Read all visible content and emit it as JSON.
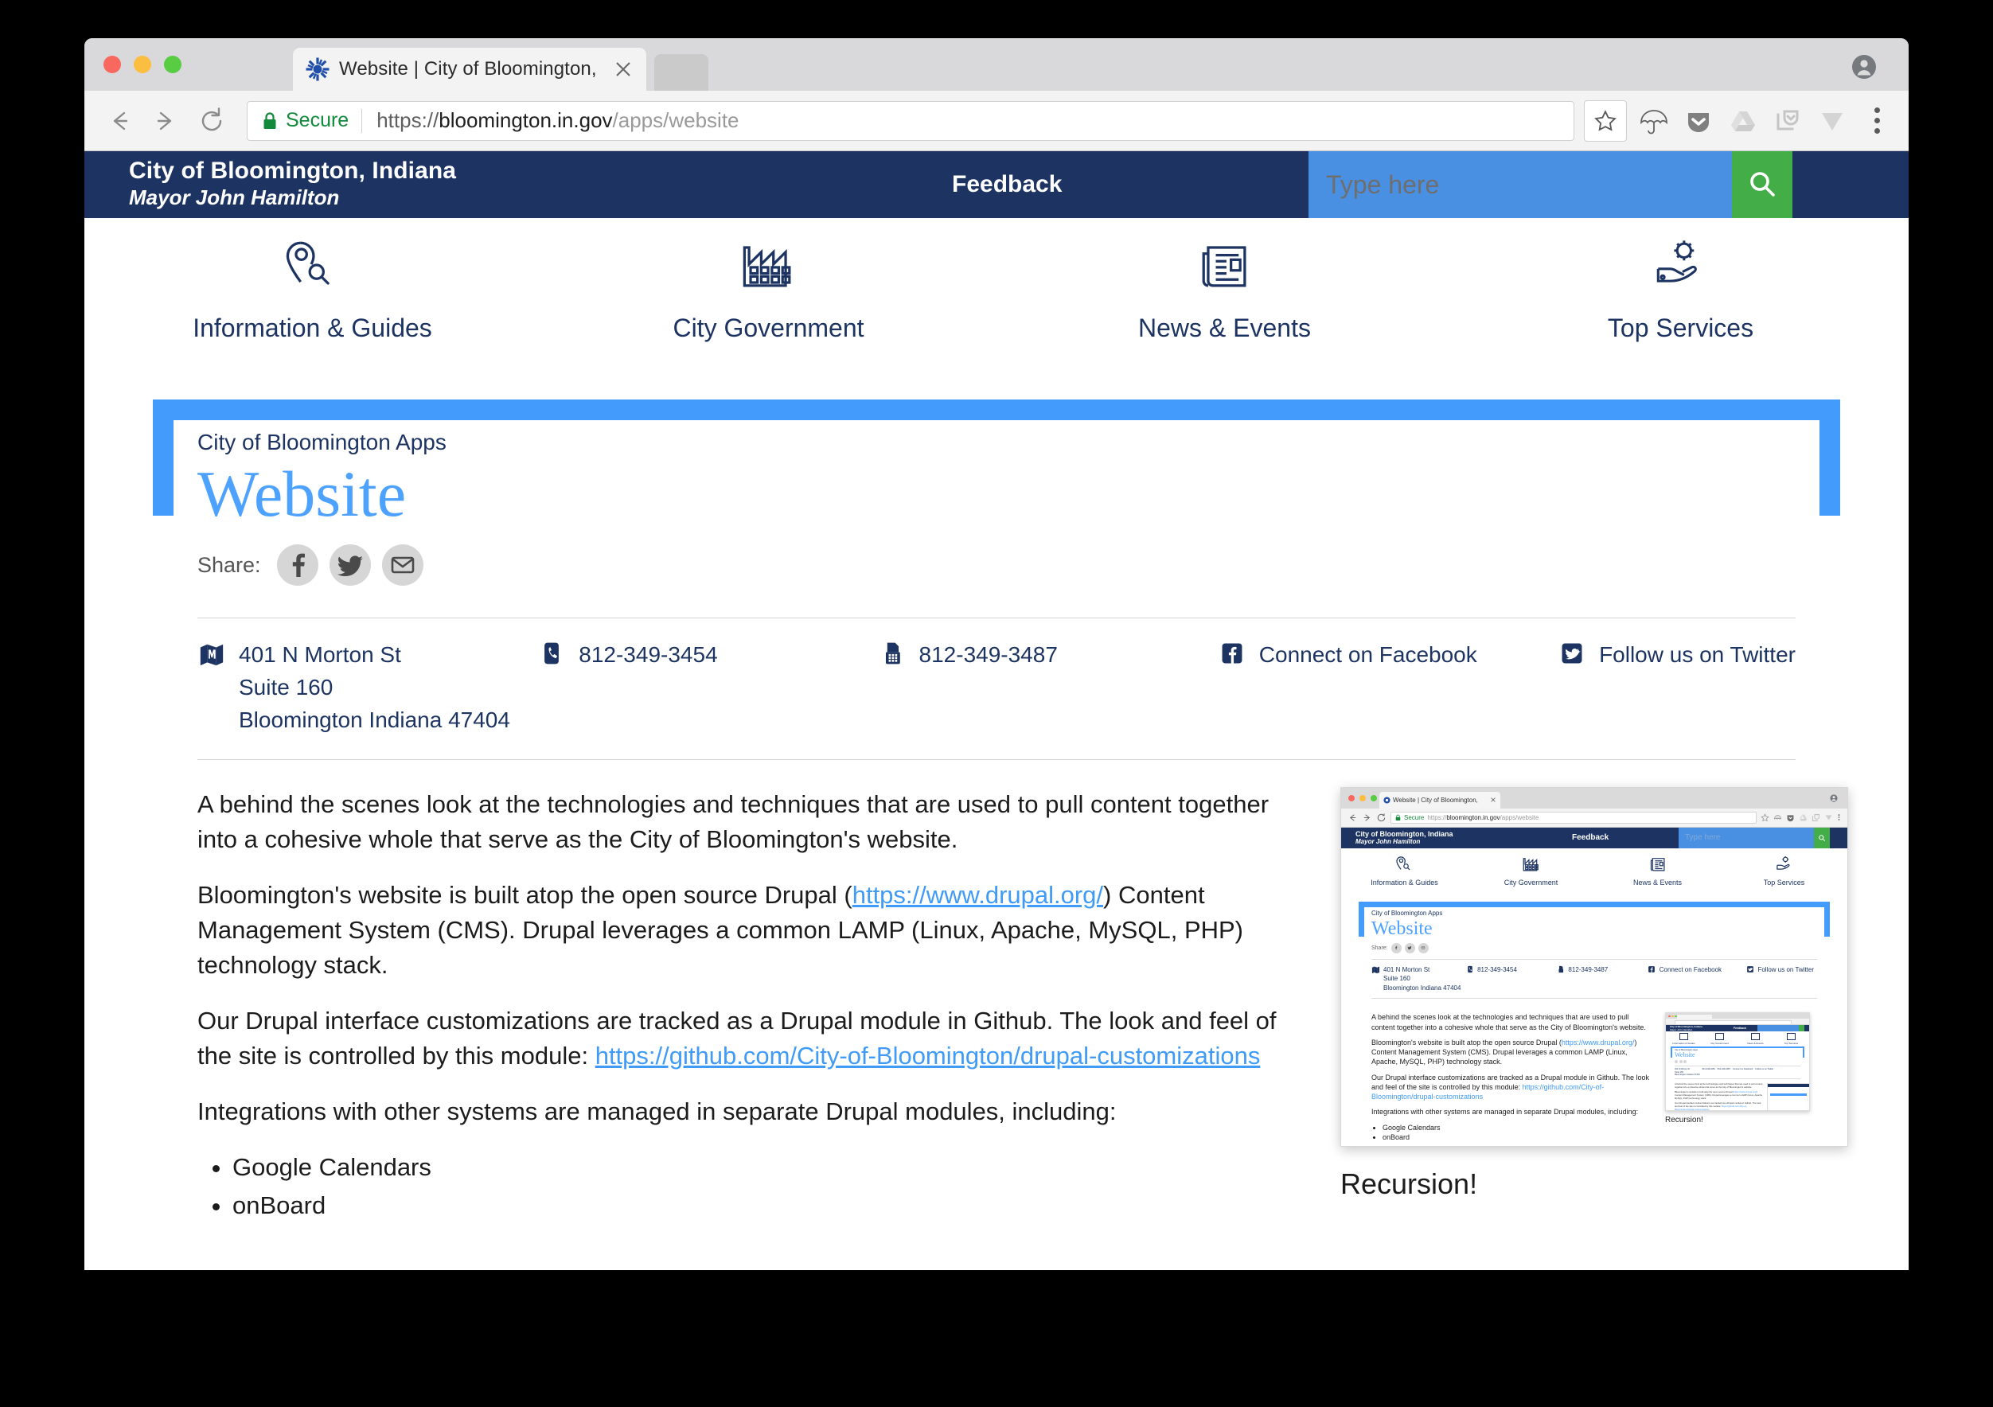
{
  "browser": {
    "tab_title": "Website | City of Bloomington,",
    "secure_label": "Secure",
    "url_scheme": "https://",
    "url_domain": "bloomington.in.gov",
    "url_path": "/apps/website",
    "icons": {
      "back": "back-arrow-icon",
      "forward": "forward-arrow-icon",
      "reload": "reload-icon",
      "lock": "lock-icon",
      "bookmark": "star-icon",
      "ext_umbrella": "umbrella-icon",
      "ext_pocket": "pocket-icon",
      "ext_drive": "google-drive-icon",
      "ext_save": "save-to-pocket-icon",
      "ext_v": "v-logo-icon",
      "menu": "three-dot-menu-icon",
      "profile": "user-avatar-icon",
      "close_tab": "close-icon",
      "favicon": "bloomington-favicon"
    }
  },
  "site_header": {
    "org_name": "City of Bloomington, Indiana",
    "mayor": "Mayor John Hamilton",
    "feedback": "Feedback",
    "search_placeholder": "Type here",
    "search_value": "",
    "search_icon": "search-icon",
    "colors": {
      "navy": "#1d3462",
      "search_blue": "#4a90e2",
      "green": "#43ad47",
      "accent_blue": "#439cfb"
    }
  },
  "nav": {
    "items": [
      {
        "label": "Information & Guides",
        "icon": "map-pin-search-icon"
      },
      {
        "label": "City Government",
        "icon": "factory-icon"
      },
      {
        "label": "News & Events",
        "icon": "newspaper-icon"
      },
      {
        "label": "Top Services",
        "icon": "hand-gear-icon"
      }
    ]
  },
  "page": {
    "eyebrow": "City of Bloomington Apps",
    "title": "Website",
    "share_label": "Share:",
    "share_buttons": [
      {
        "icon": "facebook-icon",
        "name": "share-facebook"
      },
      {
        "icon": "twitter-icon",
        "name": "share-twitter"
      },
      {
        "icon": "email-icon",
        "name": "share-email"
      }
    ]
  },
  "contact": {
    "address": {
      "icon": "map-icon",
      "line1": "401 N Morton St",
      "line2": "Suite 160",
      "line3": "Bloomington Indiana 47404"
    },
    "phone": {
      "icon": "phone-icon",
      "value": "812-349-3454"
    },
    "fax": {
      "icon": "fax-icon",
      "value": "812-349-3487"
    },
    "facebook": {
      "icon": "facebook-square-icon",
      "label": "Connect on Facebook"
    },
    "twitter": {
      "icon": "twitter-square-icon",
      "label": "Follow us on Twitter"
    }
  },
  "article": {
    "p1": "A behind the scenes look at the technologies and techniques that are used to pull content together into a cohesive whole that serve as the City of Bloomington's website.",
    "p2_before": "Bloomington's website is built atop the open source Drupal (",
    "p2_link": "https://www.drupal.org/",
    "p2_after": ") Content Management System (CMS). Drupal leverages a common LAMP (Linux, Apache, MySQL, PHP) technology stack.",
    "p3_before": "Our Drupal interface customizations are tracked as a Drupal module in Github. The look and feel of the site is controlled by this module: ",
    "p3_link": "https://github.com/City-of-Bloomington/drupal-customizations",
    "p4": "Integrations with other systems are managed in separate Drupal modules, including:",
    "list": [
      "Google Calendars",
      "onBoard"
    ]
  },
  "figure": {
    "caption": "Recursion!",
    "alt": "recursive-screenshot-of-this-page"
  }
}
